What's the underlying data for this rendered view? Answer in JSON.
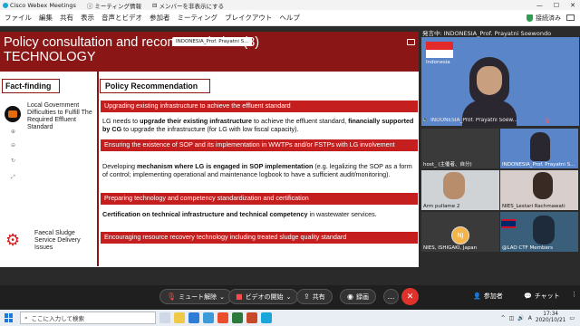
{
  "window": {
    "app_title": "Cisco Webex Meetings",
    "tab_meeting_info": "ミーティング情報",
    "tab_members": "メンバーを非表示にする"
  },
  "menu": {
    "items": [
      "ファイル",
      "編集",
      "共有",
      "表示",
      "音声とビデオ",
      "参加者",
      "ミーティング",
      "ブレイクアウト",
      "ヘルプ"
    ],
    "connection_status": "接続済み"
  },
  "slide": {
    "title_line1": "Policy consultation and recommendation (3)",
    "title_line2": "TECHNOLOGY",
    "share_tag": "INDONESIA_Prof. Prayatni S...",
    "fact_finding_header": "Fact-finding",
    "policy_header": "Policy Recommendation",
    "fact1": "Local Government Difficulties to Fulfill The Required Effluent Standard",
    "fact2": "Faecal Sludge Service Delivery Issues",
    "recommendations": [
      {
        "heading": "Upgrading existing infrastructure to achieve the effluent standard",
        "body_pre": "LG needs to ",
        "body_bold1": "upgrade their existing infrastructure",
        "body_mid": " to achieve the effluent standard, ",
        "body_bold2": "financially supported by CG",
        "body_post": " to upgrade the infrastructure (for LG with low fiscal capacity)."
      },
      {
        "heading": "Ensuring the existence of SOP and its implementation in WWTPs and/or FSTPs with LG involvement",
        "body_pre": "Developing ",
        "body_bold1": "mechanism where LG is engaged in SOP implementation",
        "body_post": " (e.g. legalizing the SOP as a form of control; implementing operational and maintenance logbook to have a sufficient audit/monitoring)."
      },
      {
        "heading": "Preparing technology and competency standardization and certification",
        "body_bold1": "Certification on technical infrastructure and technical competency",
        "body_post": " in wastewater services."
      },
      {
        "heading": "Encouraging resource recovery technology including treated sludge quality standard"
      }
    ]
  },
  "panel": {
    "speaker_label": "発言中: INDONESIA_Prof. Prayatni Soewondo",
    "flag_label": "Indonesia",
    "main_name": "INDONESIA_Prof. Prayatni Soew...",
    "tiles": [
      {
        "name": "host_ (主催者、自分)"
      },
      {
        "name": "INDONESIA_Prof. Prayatni S..."
      },
      {
        "name": "Arm pullame 2"
      },
      {
        "name": "NIES_Lestari Rachmawati"
      },
      {
        "name": "NIES, ISHIGAKI, Japan"
      },
      {
        "name": "@LAO CTF Members"
      }
    ],
    "avatar_initials": "NJ"
  },
  "controls": {
    "unmute": "ミュート解除",
    "video_start": "ビデオの開始",
    "share": "共有",
    "record": "録画",
    "participants": "参加者",
    "chat": "チャット",
    "more_icon": "ellipsis-icon",
    "end_icon": "close-icon"
  },
  "taskbar": {
    "search_placeholder": "ここに入力して検索",
    "time": "17:34",
    "date": "2020/10/21",
    "lang": "A"
  },
  "colors": {
    "slide_header": "#8a1616",
    "rec_bar": "#c41e1e",
    "end_button": "#e0322d",
    "video_bg": "#5a86c9"
  }
}
